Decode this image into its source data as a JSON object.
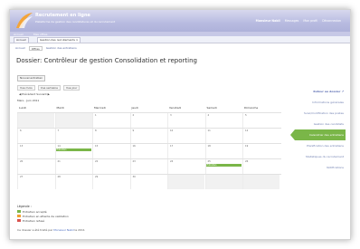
{
  "header": {
    "brand_title": "Recrutement en ligne",
    "brand_subtitle": "Plateforme de gestion des candidatures et du recrutement",
    "user_name": "Monsieur Nabil",
    "user_links": [
      "Messages",
      "Mon profil",
      "Déconnexion"
    ]
  },
  "sub_banner": {
    "items": [
      "Accueil",
      "Mes offres"
    ]
  },
  "tabs": [
    {
      "label": "Accueil"
    },
    {
      "label": "Gestion des recrutements ×"
    }
  ],
  "breadcrumbs": [
    "Accueil",
    "Offres",
    "Gestion des entretiens"
  ],
  "page_title": "Dossier: Contrôleur de gestion Consolidation et reporting",
  "button_label": "Nouvel entretien",
  "views": [
    "Vue mois",
    "Vue semaine",
    "Vue jour"
  ],
  "pager": "◀ Précédent   Suivant ▶",
  "month_label": "Mars - Juin 2011",
  "calendar": {
    "days": [
      "Lundi",
      "Mardi",
      "Mercredi",
      "Jeudi",
      "Vendredi",
      "Samedi",
      "Dimanche"
    ],
    "weeks": [
      [
        {
          "n": "",
          "dim": true
        },
        {
          "n": "",
          "dim": true
        },
        {
          "n": "1",
          "dim": false
        },
        {
          "n": "2",
          "dim": false
        },
        {
          "n": "3",
          "dim": false
        },
        {
          "n": "4",
          "dim": false
        },
        {
          "n": "5",
          "dim": false
        }
      ],
      [
        {
          "n": "6",
          "dim": false
        },
        {
          "n": "7",
          "dim": false
        },
        {
          "n": "8",
          "dim": false
        },
        {
          "n": "9",
          "dim": false
        },
        {
          "n": "10",
          "dim": false
        },
        {
          "n": "11",
          "dim": false
        },
        {
          "n": "12",
          "dim": false
        }
      ],
      [
        {
          "n": "13",
          "dim": false
        },
        {
          "n": "14",
          "dim": false
        },
        {
          "n": "15",
          "dim": false
        },
        {
          "n": "16",
          "dim": false
        },
        {
          "n": "17",
          "dim": false
        },
        {
          "n": "18",
          "dim": false
        },
        {
          "n": "19",
          "dim": false
        }
      ],
      [
        {
          "n": "20",
          "dim": false
        },
        {
          "n": "21",
          "dim": false
        },
        {
          "n": "22",
          "dim": false
        },
        {
          "n": "23",
          "dim": false
        },
        {
          "n": "24",
          "dim": false
        },
        {
          "n": "25",
          "dim": false
        },
        {
          "n": "26",
          "dim": false
        }
      ],
      [
        {
          "n": "27",
          "dim": false
        },
        {
          "n": "28",
          "dim": false
        },
        {
          "n": "29",
          "dim": false
        },
        {
          "n": "30",
          "dim": false
        },
        {
          "n": "",
          "dim": true
        },
        {
          "n": "",
          "dim": true
        },
        {
          "n": "",
          "dim": true
        }
      ]
    ],
    "events": [
      {
        "label": "Entretien",
        "week": 2,
        "day": 1,
        "color": "#7ab648"
      },
      {
        "label": "Entretien",
        "week": 3,
        "day": 5,
        "color": "#7ab648"
      }
    ]
  },
  "legend": {
    "title": "Légende :",
    "items": [
      {
        "label": "Entretien accepté",
        "color": "#7ab648"
      },
      {
        "label": "Entretien en attente de validation",
        "color": "#f0a030"
      },
      {
        "label": "Entretien refusé",
        "color": "#d9534f"
      }
    ]
  },
  "footer": {
    "text": "Ce dossier a été traité par",
    "link": "Monsieur Nabil",
    "suffix": "le 2011"
  },
  "sidebar": {
    "items": [
      {
        "label": "Retour au dossier ↗",
        "head": true,
        "active": false
      },
      {
        "label": "Informations générales",
        "head": false,
        "active": false
      },
      {
        "label": "Suivi/modification des postes",
        "head": false,
        "active": false
      },
      {
        "label": "Gestion des candidats",
        "head": false,
        "active": false
      },
      {
        "label": "Calendrier des entretiens",
        "head": false,
        "active": true
      },
      {
        "label": "Planification des entretiens",
        "head": false,
        "active": false
      },
      {
        "label": "Statistiques du recrutement",
        "head": false,
        "active": false
      },
      {
        "label": "Notifications",
        "head": false,
        "active": false
      }
    ]
  },
  "colors": {
    "accent": "#7ab648",
    "banner": "#b8bbe0",
    "link": "#6f7fb0"
  }
}
